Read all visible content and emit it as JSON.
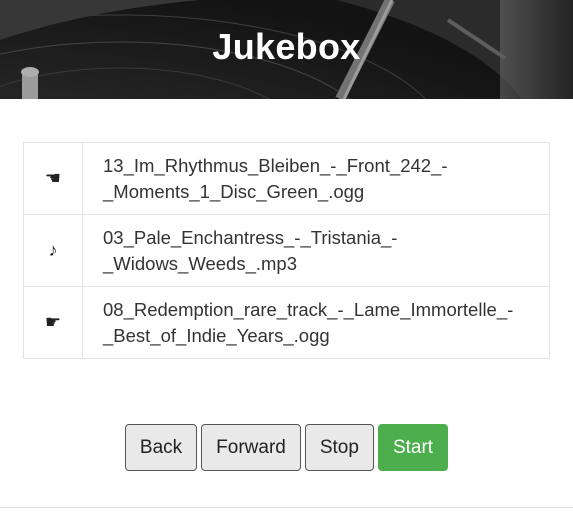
{
  "header": {
    "title": "Jukebox"
  },
  "playlist": {
    "tracks": [
      {
        "icon": "☚",
        "icon_name": "hand-pointing-left-icon",
        "filename": "13_Im_Rhythmus_Bleiben_-_Front_242_-_Moments_1_Disc_Green_.ogg"
      },
      {
        "icon": "♪",
        "icon_name": "music-note-icon",
        "filename": "03_Pale_Enchantress_-_Tristania_-_Widows_Weeds_.mp3"
      },
      {
        "icon": "☛",
        "icon_name": "hand-pointing-right-icon",
        "filename": "08_Redemption_rare_track_-_Lame_Immortelle_-_Best_of_Indie_Years_.ogg"
      }
    ]
  },
  "controls": {
    "back_label": "Back",
    "forward_label": "Forward",
    "stop_label": "Stop",
    "start_label": "Start"
  },
  "colors": {
    "start_button": "#4cae4c",
    "header_overlay": "#2b2b2b"
  }
}
